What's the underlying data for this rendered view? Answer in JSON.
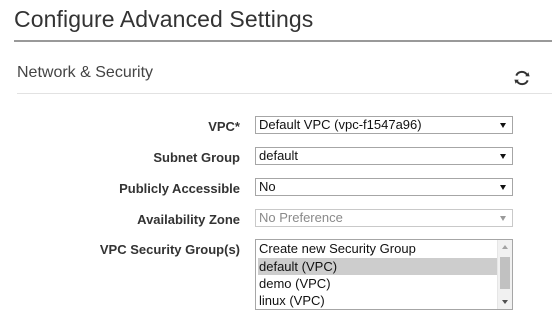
{
  "page": {
    "title": "Configure Advanced Settings"
  },
  "section": {
    "title": "Network & Security",
    "refresh_icon": "refresh-icon"
  },
  "fields": {
    "vpc": {
      "label": "VPC*",
      "value": "Default VPC (vpc-f1547a96)"
    },
    "subnet_group": {
      "label": "Subnet Group",
      "value": "default"
    },
    "publicly_accessible": {
      "label": "Publicly Accessible",
      "value": "No"
    },
    "availability_zone": {
      "label": "Availability Zone",
      "value": "No Preference",
      "disabled": true
    },
    "vpc_security_groups": {
      "label": "VPC Security Group(s)",
      "options": [
        {
          "label": "Create new Security Group",
          "selected": false
        },
        {
          "label": "default (VPC)",
          "selected": true
        },
        {
          "label": "demo (VPC)",
          "selected": false
        },
        {
          "label": "linux (VPC)",
          "selected": false
        }
      ]
    }
  },
  "colors": {
    "text": "#333333",
    "rule": "#999999",
    "selected_option_bg": "#cdcdcd"
  }
}
